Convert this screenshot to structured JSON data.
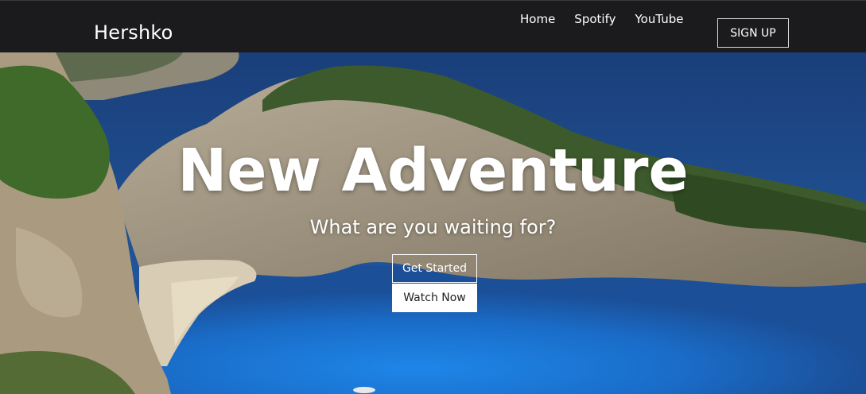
{
  "navbar": {
    "brand": "Hershko",
    "links": [
      "Home",
      "Spotify",
      "YouTube"
    ],
    "signup_label": "SIGN UP"
  },
  "hero": {
    "title": "New Adventure",
    "subtitle": "What are you waiting for?",
    "primary_button": "Get Started",
    "secondary_button": "Watch Now",
    "background": "beach-cove-sea-image"
  },
  "colors": {
    "navbar_bg": "#1b1a1d",
    "text": "#ffffff",
    "sea_deep": "#1d4f94",
    "sea_bright": "#1f7ad8",
    "sand": "#d8cdb4",
    "cliff": "#a89a82",
    "vegetation": "#3d5a2c"
  }
}
